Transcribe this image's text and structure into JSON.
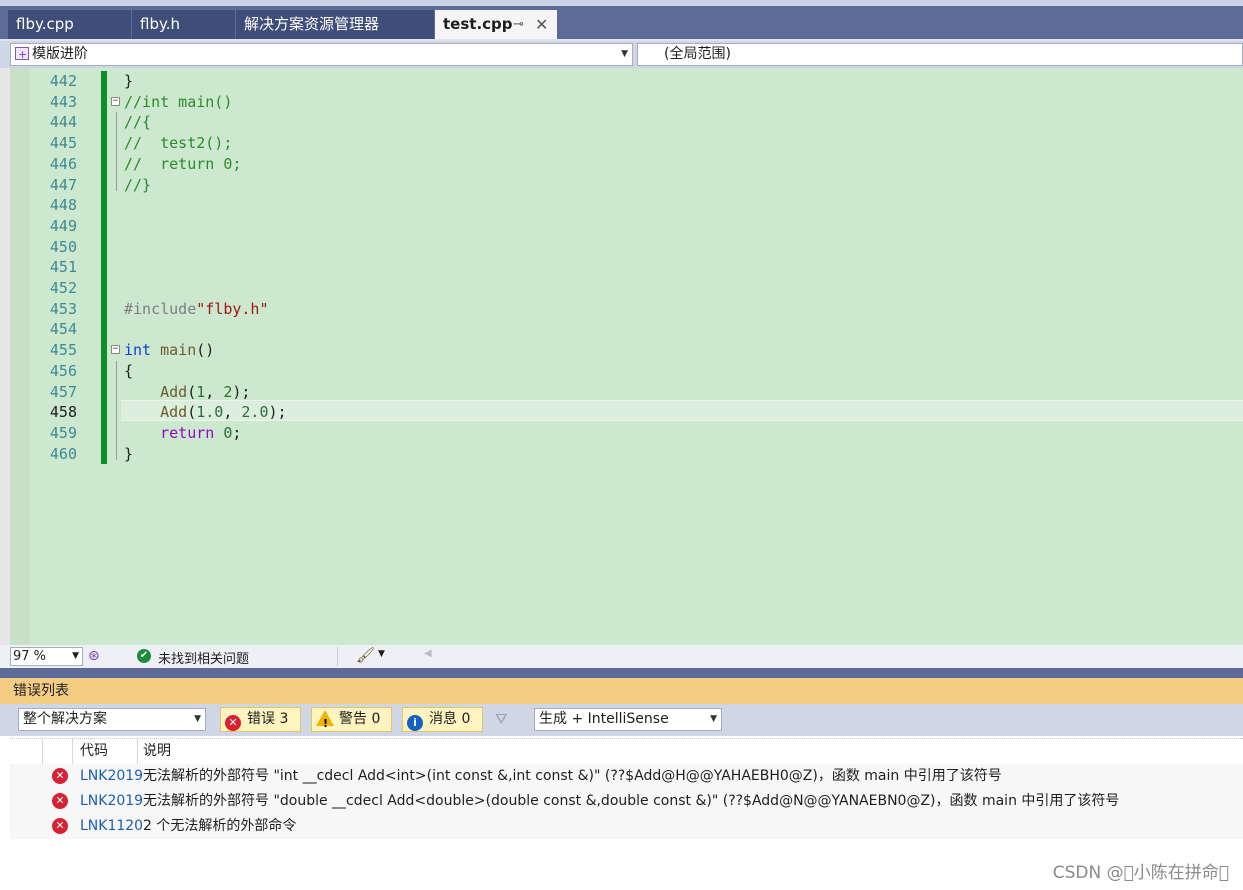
{
  "tabs": [
    {
      "label": "flby.cpp",
      "active": false
    },
    {
      "label": "flby.h",
      "active": false
    },
    {
      "label": "解决方案资源管理器",
      "active": false
    },
    {
      "label": "test.cpp",
      "active": true
    }
  ],
  "tab_pin_glyph": "⊸",
  "tab_close_glyph": "✕",
  "nav": {
    "project": "模版进阶",
    "scope": "(全局范围)"
  },
  "lines": [
    {
      "n": "442",
      "tokens": [
        {
          "t": "}",
          "c": ""
        }
      ]
    },
    {
      "n": "443",
      "tokens": [
        {
          "t": "//int main()",
          "c": "tok-comment"
        }
      ]
    },
    {
      "n": "444",
      "tokens": [
        {
          "t": "//{",
          "c": "tok-comment"
        }
      ]
    },
    {
      "n": "445",
      "tokens": [
        {
          "t": "//  test2();",
          "c": "tok-comment"
        }
      ]
    },
    {
      "n": "446",
      "tokens": [
        {
          "t": "//  return 0;",
          "c": "tok-comment"
        }
      ]
    },
    {
      "n": "447",
      "tokens": [
        {
          "t": "//}",
          "c": "tok-comment"
        }
      ]
    },
    {
      "n": "448",
      "tokens": []
    },
    {
      "n": "449",
      "tokens": []
    },
    {
      "n": "450",
      "tokens": []
    },
    {
      "n": "451",
      "tokens": []
    },
    {
      "n": "452",
      "tokens": []
    },
    {
      "n": "453",
      "tokens": [
        {
          "t": "#include",
          "c": "tok-pre"
        },
        {
          "t": "\"flby.h\"",
          "c": "tok-str"
        }
      ]
    },
    {
      "n": "454",
      "tokens": []
    },
    {
      "n": "455",
      "tokens": [
        {
          "t": "int",
          "c": "tok-kw"
        },
        {
          "t": " ",
          "c": ""
        },
        {
          "t": "main",
          "c": "tok-fn"
        },
        {
          "t": "()",
          "c": ""
        }
      ]
    },
    {
      "n": "456",
      "tokens": [
        {
          "t": "{",
          "c": ""
        }
      ]
    },
    {
      "n": "457",
      "tokens": [
        {
          "t": "    ",
          "c": ""
        },
        {
          "t": "Add",
          "c": "tok-fn"
        },
        {
          "t": "(",
          "c": ""
        },
        {
          "t": "1",
          "c": "tok-num"
        },
        {
          "t": ", ",
          "c": ""
        },
        {
          "t": "2",
          "c": "tok-num"
        },
        {
          "t": ");",
          "c": ""
        }
      ]
    },
    {
      "n": "458",
      "tokens": [
        {
          "t": "    ",
          "c": ""
        },
        {
          "t": "Add",
          "c": "tok-fn"
        },
        {
          "t": "(",
          "c": ""
        },
        {
          "t": "1.0",
          "c": "tok-num"
        },
        {
          "t": ", ",
          "c": ""
        },
        {
          "t": "2.0",
          "c": "tok-num"
        },
        {
          "t": ");",
          "c": ""
        }
      ]
    },
    {
      "n": "459",
      "tokens": [
        {
          "t": "    ",
          "c": ""
        },
        {
          "t": "return",
          "c": "tok-ret"
        },
        {
          "t": " ",
          "c": ""
        },
        {
          "t": "0",
          "c": "tok-num"
        },
        {
          "t": ";",
          "c": ""
        }
      ]
    },
    {
      "n": "460",
      "tokens": [
        {
          "t": "}",
          "c": ""
        }
      ]
    }
  ],
  "current_line": "458",
  "status": {
    "zoom": "97 %",
    "issues": "未找到相关问题"
  },
  "error_list": {
    "title": "错误列表",
    "scope": "整个解决方案",
    "errors_label": "错误 3",
    "warnings_label": "警告 0",
    "messages_label": "消息 0",
    "source": "生成 + IntelliSense",
    "col_code": "代码",
    "col_desc": "说明",
    "rows": [
      {
        "code": "LNK2019",
        "desc": "无法解析的外部符号 \"int __cdecl Add<int>(int const &,int const &)\" (??$Add@H@@YAHAEBH0@Z)，函数 main 中引用了该符号"
      },
      {
        "code": "LNK2019",
        "desc": "无法解析的外部符号 \"double __cdecl Add<double>(double const &,double const &)\" (??$Add@N@@YANAEBN0@Z)，函数 main 中引用了该符号"
      },
      {
        "code": "LNK1120",
        "desc": "2 个无法解析的外部命令"
      }
    ]
  },
  "watermark": "CSDN @\u0000小陈在拼命\u0000"
}
